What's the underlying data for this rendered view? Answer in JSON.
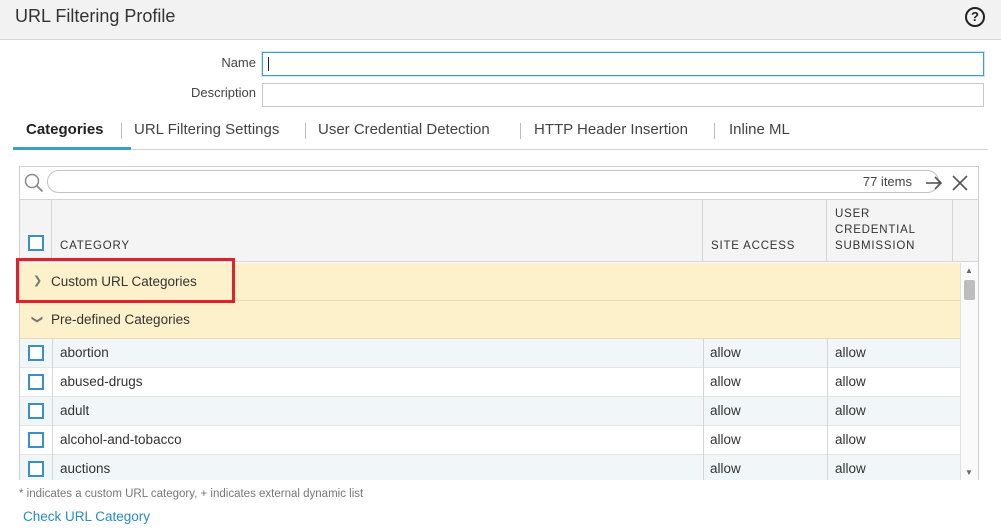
{
  "window": {
    "title": "URL Filtering Profile",
    "help_glyph": "?"
  },
  "form": {
    "name_label": "Name",
    "name_value": "",
    "description_label": "Description",
    "description_value": ""
  },
  "tabs": [
    {
      "label": "Categories",
      "active": true
    },
    {
      "label": "URL Filtering Settings",
      "active": false
    },
    {
      "label": "User Credential Detection",
      "active": false
    },
    {
      "label": "HTTP Header Insertion",
      "active": false
    },
    {
      "label": "Inline ML",
      "active": false
    }
  ],
  "filter": {
    "value": "",
    "items_count": "77 items"
  },
  "table": {
    "headers": {
      "category": "CATEGORY",
      "site_access": "SITE ACCESS",
      "user_credential_submission": "USER\nCREDENTIAL\nSUBMISSION"
    },
    "groups": [
      {
        "label": "Custom URL Categories",
        "expanded": false
      },
      {
        "label": "Pre-defined Categories",
        "expanded": true
      }
    ],
    "rows": [
      {
        "category": "abortion",
        "site_access": "allow",
        "user_credential_submission": "allow"
      },
      {
        "category": "abused-drugs",
        "site_access": "allow",
        "user_credential_submission": "allow"
      },
      {
        "category": "adult",
        "site_access": "allow",
        "user_credential_submission": "allow"
      },
      {
        "category": "alcohol-and-tobacco",
        "site_access": "allow",
        "user_credential_submission": "allow"
      },
      {
        "category": "auctions",
        "site_access": "allow",
        "user_credential_submission": "allow"
      }
    ]
  },
  "footer": {
    "note": "* indicates a custom URL category, + indicates external dynamic list",
    "check_link": "Check URL Category"
  },
  "colors": {
    "accent": "#3a8fc9",
    "group_bg": "#fdf1cb",
    "highlight": "#e0202a",
    "link": "#2a8ac2"
  }
}
